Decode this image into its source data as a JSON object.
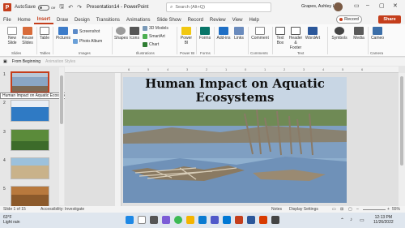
{
  "titlebar": {
    "autosave_label": "AutoSave",
    "autosave_state": "Off",
    "document": "Presentation14",
    "app": "PowerPoint",
    "search_placeholder": "Search (Alt+Q)",
    "user_name": "Grapes, Ashley L"
  },
  "menu": {
    "tabs": [
      "File",
      "Home",
      "Insert",
      "Draw",
      "Design",
      "Transitions",
      "Animations",
      "Slide Show",
      "Record",
      "Review",
      "View",
      "Help"
    ],
    "active": "Insert",
    "record_label": "Record",
    "share_label": "Share"
  },
  "ribbon": {
    "new_slide": "New Slide",
    "reuse_slides": "Reuse Slides",
    "table": "Table",
    "pictures": "Pictures",
    "screenshot": "Screenshot",
    "photo_album": "Photo Album",
    "shapes": "Shapes",
    "icons": "Icons",
    "models_3d": "3D Models",
    "smartart": "SmartArt",
    "chart": "Chart",
    "powerbi": "Power BI",
    "forms": "Forms",
    "addins": "Add-ins",
    "links": "Links",
    "comment": "Comment",
    "text_box": "Text Box",
    "header_footer": "Header & Footer",
    "wordart": "WordArt",
    "symbols": "Symbols",
    "media": "Media",
    "cameo": "Cameo",
    "groups": {
      "slides": "Slides",
      "tables": "Tables",
      "images": "Images",
      "illustrations": "Illustrations",
      "powerbi": "Power BI",
      "forms": "Forms",
      "comments": "Comments",
      "text": "Text",
      "camera": "Camera"
    }
  },
  "qat": {
    "from_beginning": "From Beginning",
    "animation_styles": "Animation Styles"
  },
  "thumbnails": {
    "numbers": [
      "1",
      "2",
      "3",
      "4",
      "5"
    ],
    "tooltip": "Human Impact on Aquatic Ecosyste..."
  },
  "ruler": {
    "top_ticks": [
      "6",
      "5",
      "4",
      "3",
      "2",
      "1",
      "0",
      "1",
      "2",
      "3",
      "4",
      "5",
      "6"
    ]
  },
  "slide": {
    "title_line1": "Human Impact on Aquatic",
    "title_line2": "Ecosystems"
  },
  "status": {
    "slide_info": "Slide 1 of 15",
    "accessibility": "Accessibility: Investigate",
    "notes": "Notes",
    "display_settings": "Display Settings",
    "zoom": "55%"
  },
  "taskbar": {
    "temperature": "63°F",
    "weather": "Light rain",
    "time": "12:13 PM",
    "date": "11/26/2022"
  },
  "colors": {
    "accent": "#c43e1c",
    "ribbon_bg": "#fafafa",
    "water": "#8aa6c4"
  }
}
